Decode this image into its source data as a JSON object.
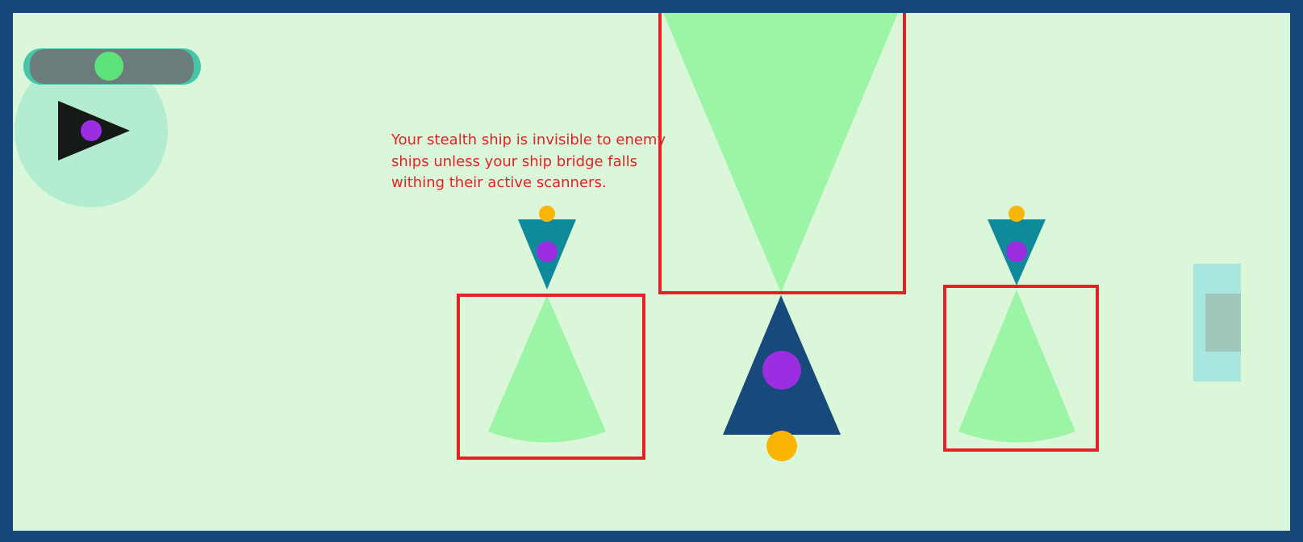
{
  "colors": {
    "border": "#16497a",
    "background": "#dbf7d9",
    "scanner_beam": "#9cf5a6",
    "highlight_box": "#e32228",
    "enemy_ship": "#0e8a9a",
    "large_ship": "#17497a",
    "ship_bridge": "#9a2ee0",
    "engine": "#fbb505",
    "player_ship": "#161a16",
    "joystick_area": "#b3ecd1",
    "slider_track": "#6b7c7c",
    "slider_rim": "#46c6a9",
    "slider_knob": "#5ce27a",
    "side_button_outer": "#a8e6e0",
    "side_button_inner": "#9fc7bc",
    "tutorial_text": "#e32228"
  },
  "hud": {
    "stealth_slider": {
      "icon": "slider-knob",
      "level": 0.48
    },
    "joystick": {
      "icon": "play-triangle-icon"
    },
    "side_button": {
      "icon": "square-button"
    }
  },
  "tutorial": {
    "text": "Your stealth ship is invisible to enemy ships unless your ship bridge falls withing their active scanners."
  },
  "entities": {
    "player_ship": {
      "icon": "triangle-ship-icon",
      "facing": "right"
    },
    "enemy_ships": [
      {
        "id": "left-enemy",
        "facing": "down",
        "scanner": "active",
        "highlighted": true
      },
      {
        "id": "center-enemy",
        "facing": "up",
        "scanner": "active",
        "highlighted": true
      },
      {
        "id": "right-enemy",
        "facing": "down",
        "scanner": "active",
        "highlighted": true
      }
    ]
  }
}
